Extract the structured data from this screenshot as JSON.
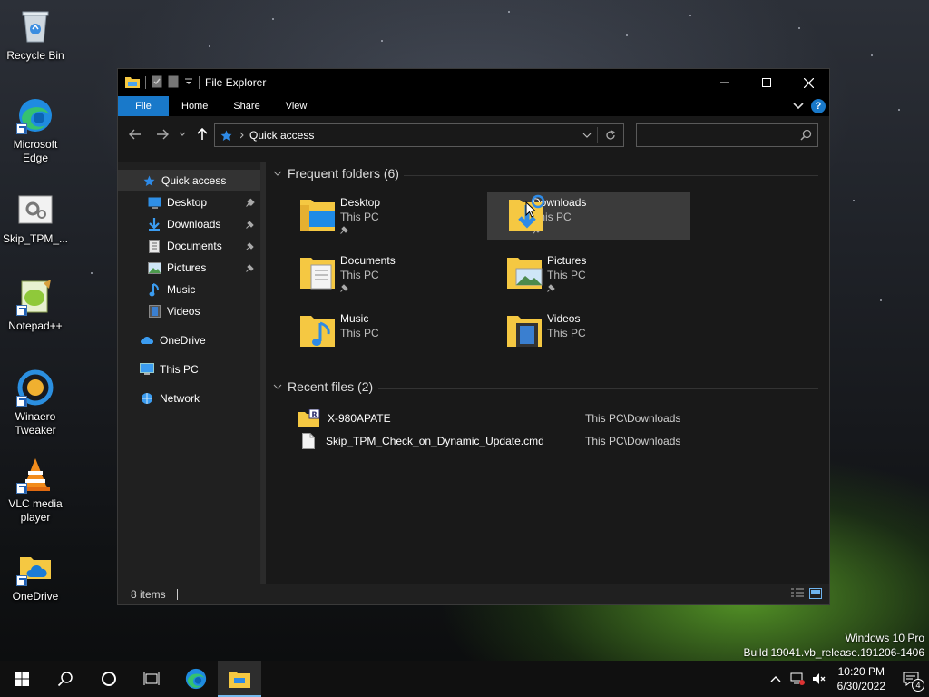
{
  "desktop": {
    "icons": [
      {
        "label": "Recycle Bin"
      },
      {
        "label": "Microsoft Edge"
      },
      {
        "label": "Skip_TPM_..."
      },
      {
        "label": "Notepad++"
      },
      {
        "label": "Winaero Tweaker"
      },
      {
        "label": "VLC media player"
      },
      {
        "label": "OneDrive"
      }
    ],
    "watermark": {
      "line1": "Windows 10 Pro",
      "line2": "Build 19041.vb_release.191206-1406"
    }
  },
  "window": {
    "title": "File Explorer",
    "ribbon_tabs": [
      "File",
      "Home",
      "Share",
      "View"
    ],
    "help_label": "?",
    "address": {
      "path": "Quick access"
    },
    "search": {
      "placeholder": ""
    },
    "nav": {
      "quick_access": "Quick access",
      "items": [
        {
          "label": "Desktop",
          "pinned": true
        },
        {
          "label": "Downloads",
          "pinned": true
        },
        {
          "label": "Documents",
          "pinned": true
        },
        {
          "label": "Pictures",
          "pinned": true
        },
        {
          "label": "Music",
          "pinned": false
        },
        {
          "label": "Videos",
          "pinned": false
        }
      ],
      "onedrive": "OneDrive",
      "this_pc": "This PC",
      "network": "Network"
    },
    "frequent": {
      "header": "Frequent folders (6)",
      "folders": [
        {
          "name": "Desktop",
          "location": "This PC",
          "pinned": true
        },
        {
          "name": "Downloads",
          "location": "This PC",
          "pinned": true
        },
        {
          "name": "Documents",
          "location": "This PC",
          "pinned": true
        },
        {
          "name": "Pictures",
          "location": "This PC",
          "pinned": true
        },
        {
          "name": "Music",
          "location": "This PC",
          "pinned": false
        },
        {
          "name": "Videos",
          "location": "This PC",
          "pinned": false
        }
      ]
    },
    "recent": {
      "header": "Recent files (2)",
      "files": [
        {
          "name": "X-980APATE",
          "location": "This PC\\Downloads"
        },
        {
          "name": "Skip_TPM_Check_on_Dynamic_Update.cmd",
          "location": "This PC\\Downloads"
        }
      ]
    },
    "status": {
      "items": "8 items"
    }
  },
  "taskbar": {
    "time": "10:20 PM",
    "date": "6/30/2022",
    "notification_count": "4"
  },
  "colors": {
    "accent": "#1979ca",
    "folder": "#f5c842",
    "desktop_bg": "#17191d"
  }
}
